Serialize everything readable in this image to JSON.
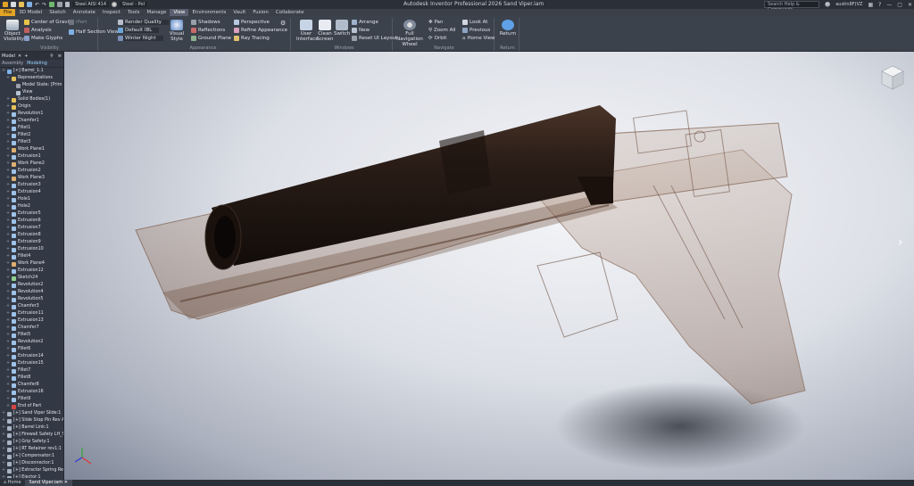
{
  "titlebar": {
    "app_title": "Autodesk Inventor Professional 2026   Sand Viper.iam",
    "material": "Steel AISI 414",
    "appearance": "Steel - Pol",
    "search_placeholder": "Search Help & Commands...",
    "user": "austin8F(VZ",
    "icons": [
      "new-icon",
      "open-icon",
      "save-icon",
      "undo-icon",
      "redo-icon",
      "home-icon"
    ]
  },
  "tabs": [
    "File",
    "3D Model",
    "Sketch",
    "Annotate",
    "Inspect",
    "Tools",
    "Manage",
    "View",
    "Environments",
    "Vault",
    "Fusion",
    "Collaborate"
  ],
  "active_tab": "View",
  "ribbon": {
    "visibility": {
      "label": "Visibility",
      "object_visibility": "Object Visibility",
      "center_of_gravity": "Center of Gravity",
      "analysis": "Analysis",
      "make_glyphs": "Make Glyphs",
      "half_section": "Half Section View",
      "iso": "iPart"
    },
    "appearance": {
      "label": "Appearance",
      "render_quality": "Render Quality",
      "default_ibl": "Default IBL",
      "winter_night": "Winter Night",
      "visual_style": "Visual Style",
      "shadows": "Shadows",
      "reflections": "Reflections",
      "ground_plane": "Ground Plane",
      "perspective": "Perspective",
      "refine_appearance": "Refine Appearance",
      "ray_tracing": "Ray Tracing"
    },
    "windows": {
      "label": "Windows",
      "user_interface": "User Interface",
      "clean_screen": "Clean Screen",
      "switch": "Switch",
      "arrange": "Arrange",
      "new": "New",
      "reset_ui_layout": "Reset UI Layout"
    },
    "navigate": {
      "label": "Navigate",
      "full_navigation_wheel": "Full Navigation Wheel",
      "pan": "Pan",
      "zoom_all": "Zoom All",
      "orbit": "Orbit",
      "look_at": "Look At",
      "previous": "Previous",
      "home_view": "Home View"
    },
    "return": {
      "label": "Return",
      "return": "Return"
    }
  },
  "browser": {
    "title": "Model",
    "tabs": [
      "Assembly",
      "Modeling"
    ],
    "active_tab": "Modeling",
    "nodes": [
      {
        "label": "[+] Barrel_1:1",
        "indent": 0,
        "icon": "assembly"
      },
      {
        "label": "Representations",
        "indent": 1,
        "icon": "folder"
      },
      {
        "label": "Model State: [Prim",
        "indent": 2,
        "icon": "state"
      },
      {
        "label": "View",
        "indent": 2,
        "icon": "view"
      },
      {
        "label": "Solid Bodies(1)",
        "indent": 1,
        "icon": "folder"
      },
      {
        "label": "Origin",
        "indent": 1,
        "icon": "folder"
      },
      {
        "label": "Revolution1",
        "indent": 1,
        "icon": "feature"
      },
      {
        "label": "Chamfer1",
        "indent": 1,
        "icon": "feature"
      },
      {
        "label": "Fillet1",
        "indent": 1,
        "icon": "feature"
      },
      {
        "label": "Fillet2",
        "indent": 1,
        "icon": "feature"
      },
      {
        "label": "Fillet3",
        "indent": 1,
        "icon": "feature"
      },
      {
        "label": "Work Plane1",
        "indent": 1,
        "icon": "plane"
      },
      {
        "label": "Extrusion1",
        "indent": 1,
        "icon": "feature"
      },
      {
        "label": "Work Plane2",
        "indent": 1,
        "icon": "plane"
      },
      {
        "label": "Extrusion2",
        "indent": 1,
        "icon": "feature"
      },
      {
        "label": "Work Plane3",
        "indent": 1,
        "icon": "plane"
      },
      {
        "label": "Extrusion3",
        "indent": 1,
        "icon": "feature"
      },
      {
        "label": "Extrusion4",
        "indent": 1,
        "icon": "feature"
      },
      {
        "label": "Hole1",
        "indent": 1,
        "icon": "feature"
      },
      {
        "label": "Hole2",
        "indent": 1,
        "icon": "feature"
      },
      {
        "label": "Extrusion5",
        "indent": 1,
        "icon": "feature"
      },
      {
        "label": "Extrusion6",
        "indent": 1,
        "icon": "feature"
      },
      {
        "label": "Extrusion7",
        "indent": 1,
        "icon": "feature"
      },
      {
        "label": "Extrusion8",
        "indent": 1,
        "icon": "feature"
      },
      {
        "label": "Extrusion9",
        "indent": 1,
        "icon": "feature"
      },
      {
        "label": "Extrusion10",
        "indent": 1,
        "icon": "feature"
      },
      {
        "label": "Fillet4",
        "indent": 1,
        "icon": "feature"
      },
      {
        "label": "Work Plane4",
        "indent": 1,
        "icon": "plane"
      },
      {
        "label": "Extrusion12",
        "indent": 1,
        "icon": "feature"
      },
      {
        "label": "Sketch24",
        "indent": 1,
        "icon": "sketch"
      },
      {
        "label": "Revolution2",
        "indent": 1,
        "icon": "feature"
      },
      {
        "label": "Revolution4",
        "indent": 1,
        "icon": "feature"
      },
      {
        "label": "Revolution5",
        "indent": 1,
        "icon": "feature"
      },
      {
        "label": "Chamfer3",
        "indent": 1,
        "icon": "feature"
      },
      {
        "label": "Extrusion11",
        "indent": 1,
        "icon": "feature"
      },
      {
        "label": "Extrusion13",
        "indent": 1,
        "icon": "feature"
      },
      {
        "label": "Chamfer7",
        "indent": 1,
        "icon": "feature"
      },
      {
        "label": "Fillet5",
        "indent": 1,
        "icon": "feature"
      },
      {
        "label": "Revolution2",
        "indent": 1,
        "icon": "feature"
      },
      {
        "label": "Fillet6",
        "indent": 1,
        "icon": "feature"
      },
      {
        "label": "Extrusion14",
        "indent": 1,
        "icon": "feature"
      },
      {
        "label": "Extrusion15",
        "indent": 1,
        "icon": "feature"
      },
      {
        "label": "Fillet7",
        "indent": 1,
        "icon": "feature"
      },
      {
        "label": "Fillet8",
        "indent": 1,
        "icon": "feature"
      },
      {
        "label": "Chamfer8",
        "indent": 1,
        "icon": "feature"
      },
      {
        "label": "Extrusion16",
        "indent": 1,
        "icon": "feature"
      },
      {
        "label": "Fillet9",
        "indent": 1,
        "icon": "feature"
      },
      {
        "label": "End of Part",
        "indent": 1,
        "icon": "end"
      },
      {
        "label": "[+] Sand Viper Slide:1",
        "indent": 0,
        "icon": "part"
      },
      {
        "label": "[+] Slide Stop Pin Rev A:1",
        "indent": 0,
        "icon": "part"
      },
      {
        "label": "[+] Barrel Link:1",
        "indent": 0,
        "icon": "part"
      },
      {
        "label": "[+] Firewall Safety LH_Sav",
        "indent": 0,
        "icon": "part"
      },
      {
        "label": "[+] Grip Safety:1",
        "indent": 0,
        "icon": "part"
      },
      {
        "label": "[+] RT Retainer rev1:1",
        "indent": 0,
        "icon": "part"
      },
      {
        "label": "[+] Compensator:1",
        "indent": 0,
        "icon": "part"
      },
      {
        "label": "[+] Disconnector:1",
        "indent": 0,
        "icon": "part"
      },
      {
        "label": "[+] Extractor Spring Retai",
        "indent": 0,
        "icon": "part"
      },
      {
        "label": "[+] Ejector:1",
        "indent": 0,
        "icon": "part"
      },
      {
        "label": "[+] Slide Stop:1",
        "indent": 0,
        "icon": "part"
      }
    ]
  },
  "statusbar": {
    "tabs": [
      "Home",
      "Sand Viper.iam"
    ],
    "active": "Sand Viper.iam"
  },
  "colors": {
    "accent": "#e2a324",
    "ribbon": "#3c424c",
    "browser": "#333944",
    "barrel": "#2a1d17"
  }
}
